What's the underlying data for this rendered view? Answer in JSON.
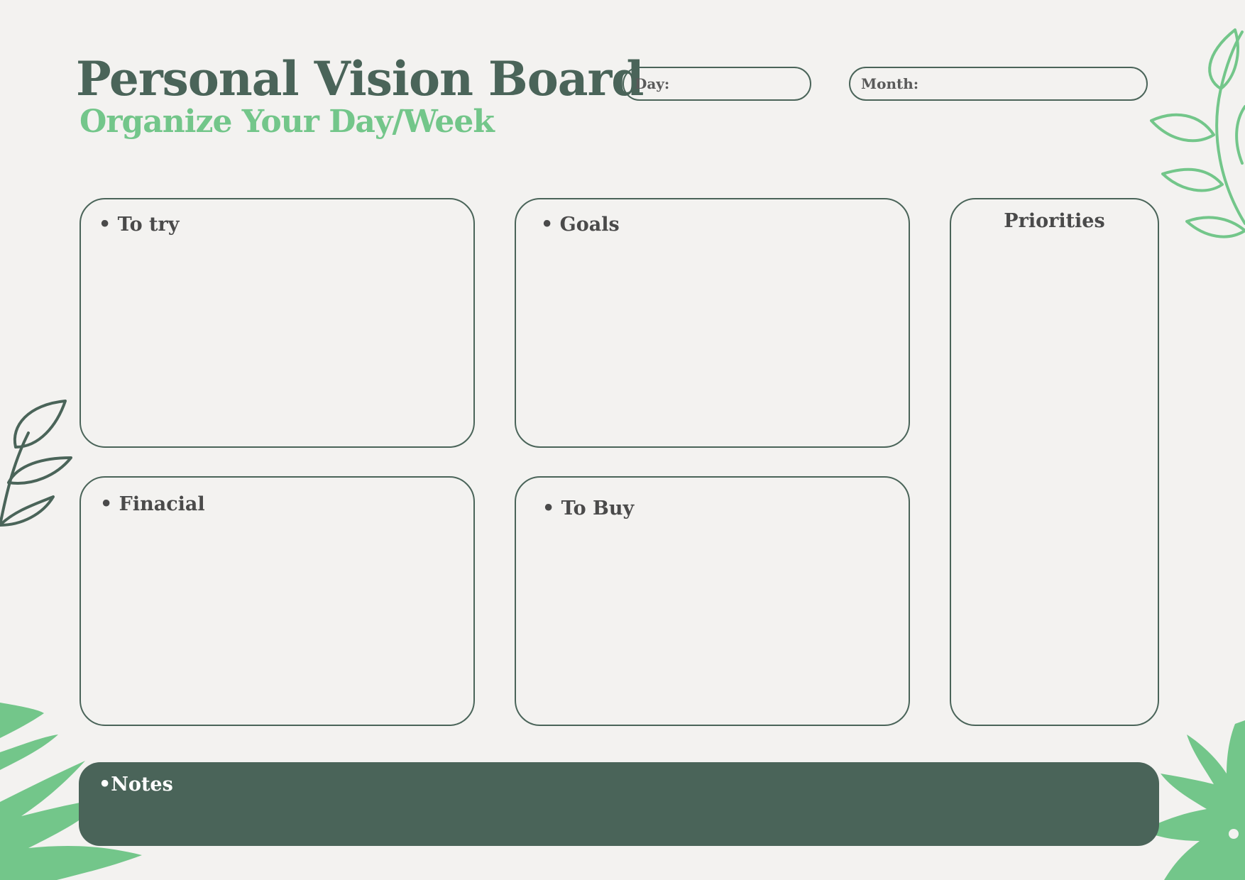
{
  "header": {
    "title": "Personal Vision Board",
    "subtitle": "Organize Your Day/Week"
  },
  "fields": {
    "day_label": "Day:",
    "month_label": "Month:"
  },
  "sections": {
    "to_try": "• To try",
    "goals": "• Goals",
    "priorities": "Priorities",
    "financial": "• Finacial",
    "to_buy": "• To Buy",
    "notes": "•Notes"
  },
  "colors": {
    "dark_green": "#4a6459",
    "light_green": "#73c68a",
    "background": "#f3f2f0",
    "label_gray": "#4a4a4a"
  },
  "icons": {
    "top_right": "leaf-branch-outline-icon",
    "mid_left": "leaf-branch-outline-icon",
    "bottom_left": "monstera-leaf-icon",
    "bottom_right": "monstera-leaf-icon"
  }
}
